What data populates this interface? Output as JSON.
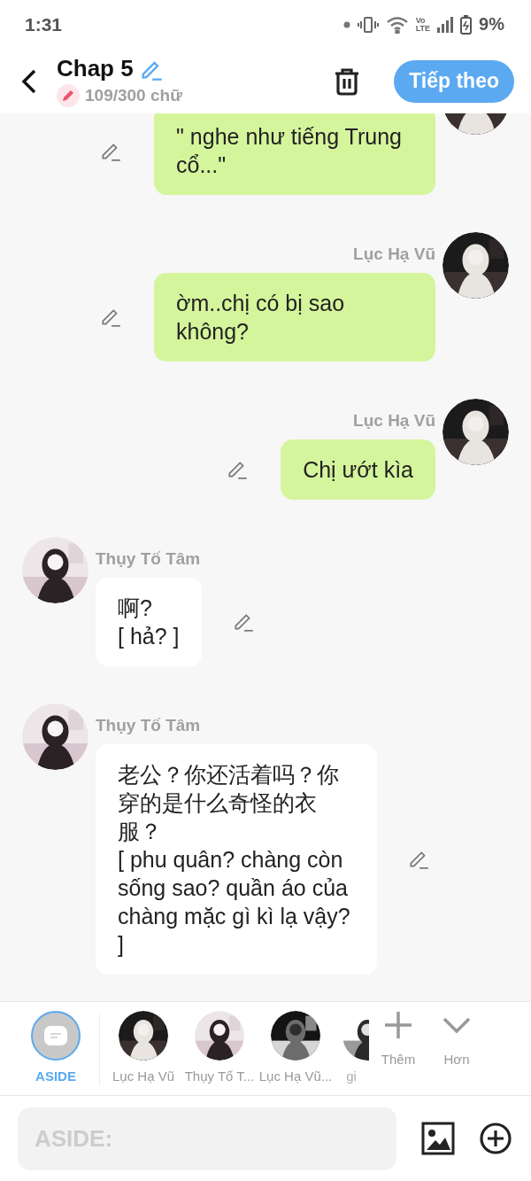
{
  "status_bar": {
    "time": "1:31",
    "volte_top": "Vo",
    "volte_bottom": "LTE",
    "battery": "9%"
  },
  "header": {
    "title": "Chap 5",
    "word_count": "109/300 chữ",
    "next_button": "Tiếp theo"
  },
  "messages": [
    {
      "kind": "outgoing",
      "text": "\" nghe như tiếng Trung cổ...\""
    },
    {
      "kind": "outgoing",
      "name": "Lục Hạ Vũ",
      "text": "ờm..chị có bị sao không?"
    },
    {
      "kind": "outgoing",
      "name": "Lục Hạ Vũ",
      "text": "Chị ướt kìa"
    },
    {
      "kind": "incoming",
      "name": "Thụy Tố Tâm",
      "text": "啊?\n[ hả? ]"
    },
    {
      "kind": "incoming",
      "name": "Thụy Tố Tâm",
      "text": "老公？你还活着吗？你穿的是什么奇怪的衣服？\n[ phu quân? chàng còn sống sao? quần áo của chàng mặc gì kì lạ vậy? ]"
    }
  ],
  "characters": [
    {
      "kind": "aside",
      "name": "ASIDE",
      "selected": true
    },
    {
      "kind": "avatar",
      "name": "Lục Hạ Vũ",
      "selected": false
    },
    {
      "kind": "avatar",
      "name": "Thụy Tố T...",
      "selected": false
    },
    {
      "kind": "avatar",
      "name": "Lục Hạ Vũ...",
      "selected": false
    },
    {
      "kind": "partial",
      "name": "gi",
      "selected": false
    }
  ],
  "actions": [
    {
      "kind": "add",
      "label": "Thêm"
    },
    {
      "kind": "more",
      "label": "Hơn"
    }
  ],
  "compose": {
    "placeholder": "ASIDE:"
  }
}
